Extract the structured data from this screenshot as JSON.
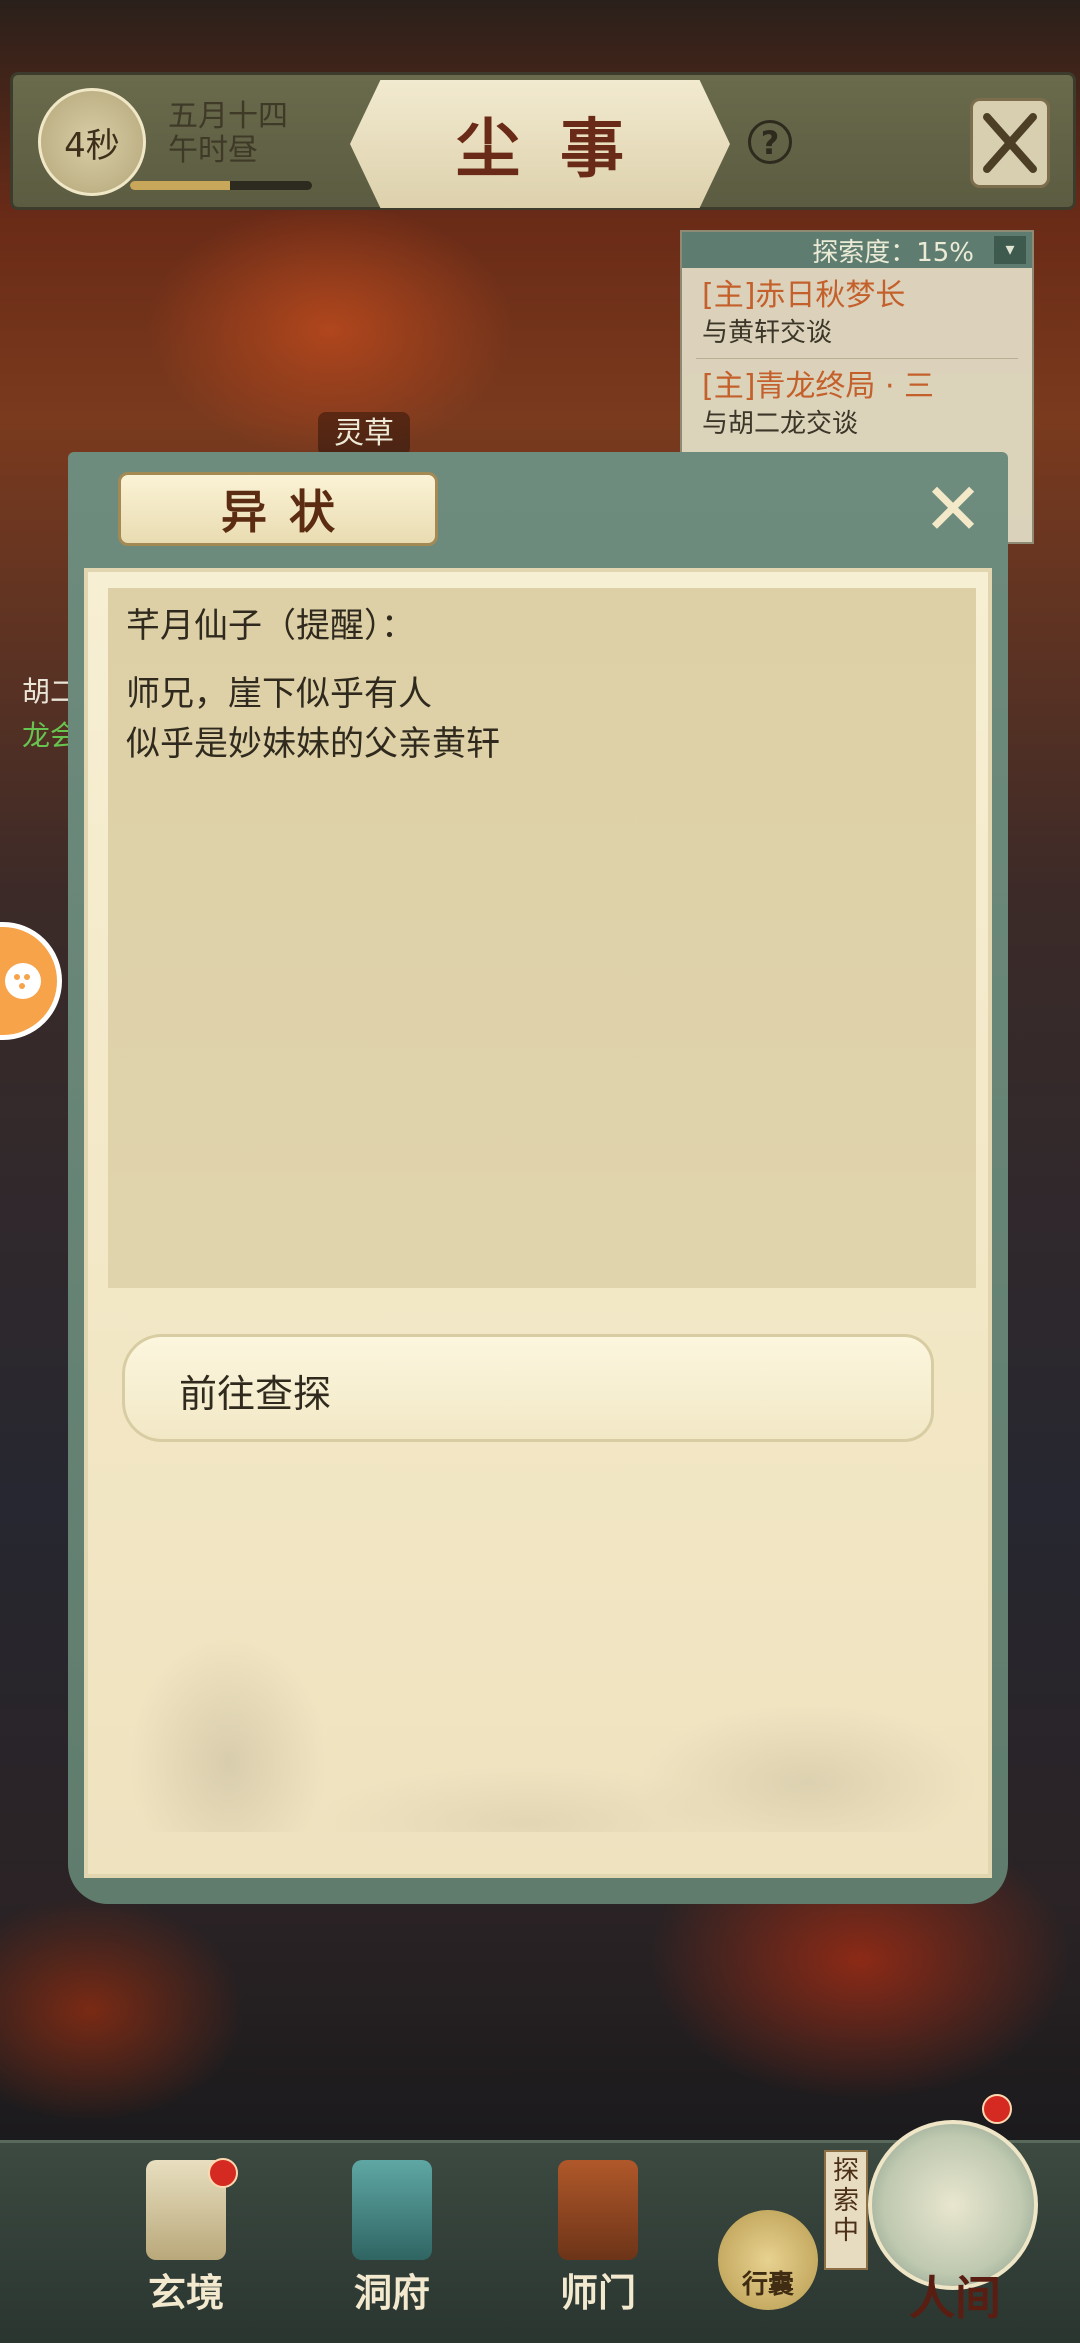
{
  "hud": {
    "timer": "4秒",
    "date": "五月十四",
    "time_of_day": "午时昼",
    "time_progress": 0.55,
    "title": "尘事",
    "help": "?"
  },
  "task_panel": {
    "progress": "探索度：15%",
    "tasks": [
      {
        "title": "[主]赤日秋梦长",
        "desc": "与黄轩交谈"
      },
      {
        "title": "[主]青龙终局 · 三",
        "desc": "与胡二龙交谈"
      }
    ]
  },
  "scene": {
    "herb_label": "灵草",
    "npc_name": "胡二",
    "npc_sub": "龙会"
  },
  "dialog": {
    "title": "异状",
    "speaker": "芊月仙子（提醒）：",
    "lines": [
      "师兄，崖下似乎有人",
      "似乎是妙妹妹的父亲黄轩"
    ],
    "choice": "前往查探"
  },
  "nav": {
    "items": [
      "玄境",
      "洞府",
      "师门"
    ],
    "bag": "行囊",
    "explore_tag": "探索中",
    "world": "人间"
  },
  "colors": {
    "accent_green": "#5f7c6d",
    "parchment": "#f2e7c5",
    "task_orange": "#c4602b",
    "title_red": "#6a2a18"
  }
}
